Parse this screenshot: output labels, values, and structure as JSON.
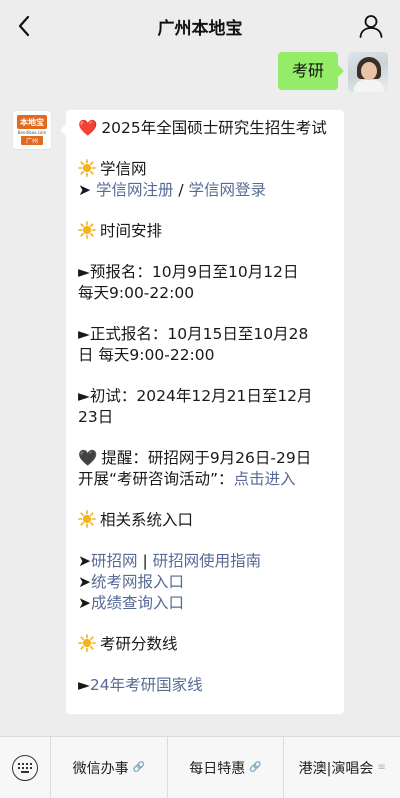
{
  "nav": {
    "title": "广州本地宝"
  },
  "outgoing": {
    "text": "考研"
  },
  "incoming": {
    "avatar": {
      "brand": "本地宝",
      "url": "Bendibao.com",
      "city": "广州"
    },
    "heading_emoji": "❤️",
    "heading": "2025年全国硕士研究生招生考试",
    "xuexin_title": "学信网",
    "arrow": "➤",
    "xuexin_register": "学信网注册",
    "sep": " / ",
    "xuexin_login": "学信网登录",
    "schedule_title": "时间安排",
    "prereg_line1": "►预报名：10月9日至10月12日",
    "prereg_line2": "每天9:00-22:00",
    "formal_line1": "►正式报名：10月15日至10月28",
    "formal_line2": "日  每天9:00-22:00",
    "exam_line1": "►初试：2024年12月21日至12月",
    "exam_line2": "23日",
    "remind_emoji": "🖤",
    "remind_line1": "提醒：研招网于9月26日-29日",
    "remind_line2_prefix": "开展“考研咨询活动”：",
    "remind_link": "点击进入",
    "systems_title": "相关系统入口",
    "yanzhao": "研招网",
    "pipe": " | ",
    "yanzhao_guide": "研招网使用指南",
    "tongkao": "统考网报入口",
    "score": "成绩查询入口",
    "cutoff_title": "考研分数线",
    "tri": "►",
    "cutoff_link": "24年考研国家线"
  },
  "bottom": {
    "menu1": "微信办事",
    "menu2": "每日特惠",
    "menu3": "港澳|演唱会",
    "link_glyph": "🔗",
    "more_glyph": "≡"
  },
  "colors": {
    "bubble_out": "#95ec69",
    "link": "#576b95",
    "sun": "#f5b21e"
  }
}
